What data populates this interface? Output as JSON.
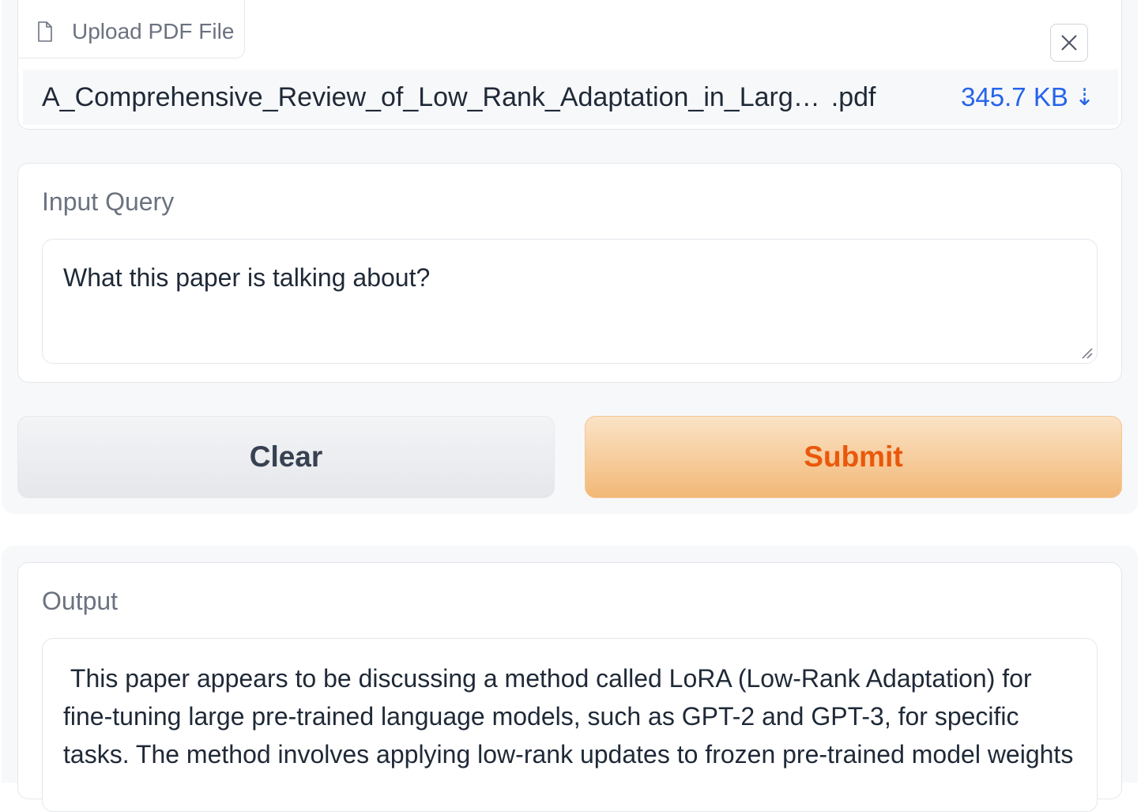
{
  "upload": {
    "tab_label": "Upload PDF File",
    "file_name": "A_Comprehensive_Review_of_Low_Rank_Adaptation_in_Larg…",
    "file_ext": ".pdf",
    "file_size": "345.7 KB",
    "icons": {
      "file": "file-icon",
      "close": "close-icon",
      "download": "download-icon"
    }
  },
  "query": {
    "label": "Input Query",
    "value": "What this paper is talking about?"
  },
  "buttons": {
    "clear": "Clear",
    "submit": "Submit"
  },
  "output": {
    "label": "Output",
    "text": " This paper appears to be discussing a method called LoRA (Low-Rank Adaptation) for\nfine-tuning large pre-trained language models, such as GPT-2 and GPT-3, for specific\ntasks. The method involves applying low-rank updates to frozen pre-trained model weights"
  },
  "colors": {
    "accent_link": "#2563eb",
    "submit_text": "#ea580c",
    "submit_bg_top": "#fbe3c6",
    "submit_bg_bottom": "#f2b877",
    "panel_bg": "#f7f8fa"
  }
}
